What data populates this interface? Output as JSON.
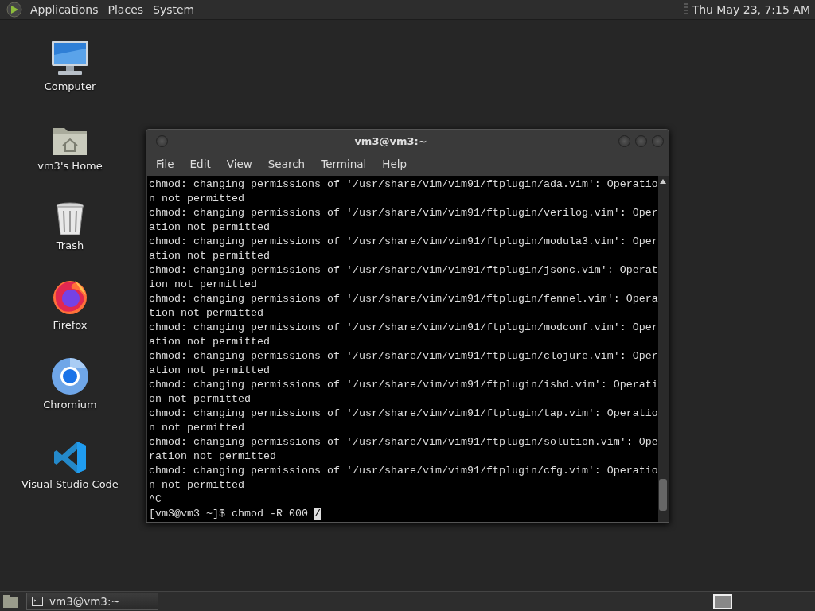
{
  "top_panel": {
    "menus": [
      "Applications",
      "Places",
      "System"
    ],
    "clock": "Thu May 23,  7:15 AM"
  },
  "desktop_icons": [
    {
      "kind": "computer",
      "label": "Computer"
    },
    {
      "kind": "home",
      "label": "vm3's Home"
    },
    {
      "kind": "trash",
      "label": "Trash"
    },
    {
      "kind": "firefox",
      "label": "Firefox"
    },
    {
      "kind": "chromium",
      "label": "Chromium"
    },
    {
      "kind": "vscode",
      "label": "Visual Studio Code"
    }
  ],
  "window": {
    "title": "vm3@vm3:~",
    "menu": [
      "File",
      "Edit",
      "View",
      "Search",
      "Terminal",
      "Help"
    ],
    "terminal_lines": [
      "chmod: changing permissions of '/usr/share/vim/vim91/ftplugin/ada.vim': Operatio",
      "n not permitted",
      "chmod: changing permissions of '/usr/share/vim/vim91/ftplugin/verilog.vim': Oper",
      "ation not permitted",
      "chmod: changing permissions of '/usr/share/vim/vim91/ftplugin/modula3.vim': Oper",
      "ation not permitted",
      "chmod: changing permissions of '/usr/share/vim/vim91/ftplugin/jsonc.vim': Operat",
      "ion not permitted",
      "chmod: changing permissions of '/usr/share/vim/vim91/ftplugin/fennel.vim': Opera",
      "tion not permitted",
      "chmod: changing permissions of '/usr/share/vim/vim91/ftplugin/modconf.vim': Oper",
      "ation not permitted",
      "chmod: changing permissions of '/usr/share/vim/vim91/ftplugin/clojure.vim': Oper",
      "ation not permitted",
      "chmod: changing permissions of '/usr/share/vim/vim91/ftplugin/ishd.vim': Operati",
      "on not permitted",
      "chmod: changing permissions of '/usr/share/vim/vim91/ftplugin/tap.vim': Operatio",
      "n not permitted",
      "chmod: changing permissions of '/usr/share/vim/vim91/ftplugin/solution.vim': Ope",
      "ration not permitted",
      "chmod: changing permissions of '/usr/share/vim/vim91/ftplugin/cfg.vim': Operatio",
      "n not permitted",
      "^C"
    ],
    "prompt": {
      "text": "[vm3@vm3 ~]$ chmod -R 000 ",
      "cursor_char": "/"
    }
  },
  "taskbar": {
    "tasks": [
      {
        "label": "vm3@vm3:~",
        "selected": true
      }
    ]
  }
}
